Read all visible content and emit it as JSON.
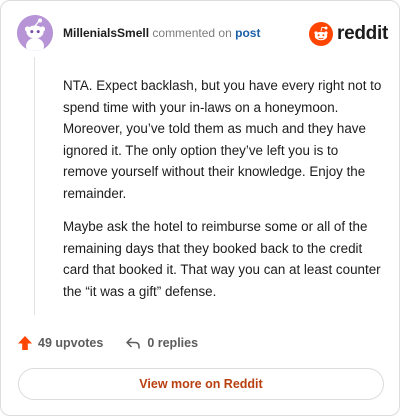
{
  "header": {
    "username": "MillenialsSmell",
    "action_text": "commented on",
    "post_link": "post",
    "brand": "reddit"
  },
  "comment": {
    "paragraphs": [
      "NTA. Expect backlash, but you have every right not to spend time with your in-laws on a honeymoon. Moreover, you’ve told them as much and they have ignored it. The only option they’ve left you is to remove yourself without their knowledge. Enjoy the remainder.",
      "Maybe ask the hotel to reimburse some or all of the remaining days that they booked back to the credit card that booked it. That way you can at least counter the “it was a gift” defense."
    ]
  },
  "actions": {
    "upvotes": "49 upvotes",
    "replies": "0 replies"
  },
  "footer": {
    "view_more": "View more on Reddit"
  },
  "colors": {
    "accent": "#ff4500",
    "link": "#1a5fa8",
    "button_text": "#b8400f",
    "avatar_bg": "#b794d6"
  },
  "icons": {
    "avatar": "snoo-avatar-icon",
    "logo": "reddit-logo-icon",
    "upvote": "upvote-arrow-icon",
    "reply": "reply-arrow-icon"
  }
}
